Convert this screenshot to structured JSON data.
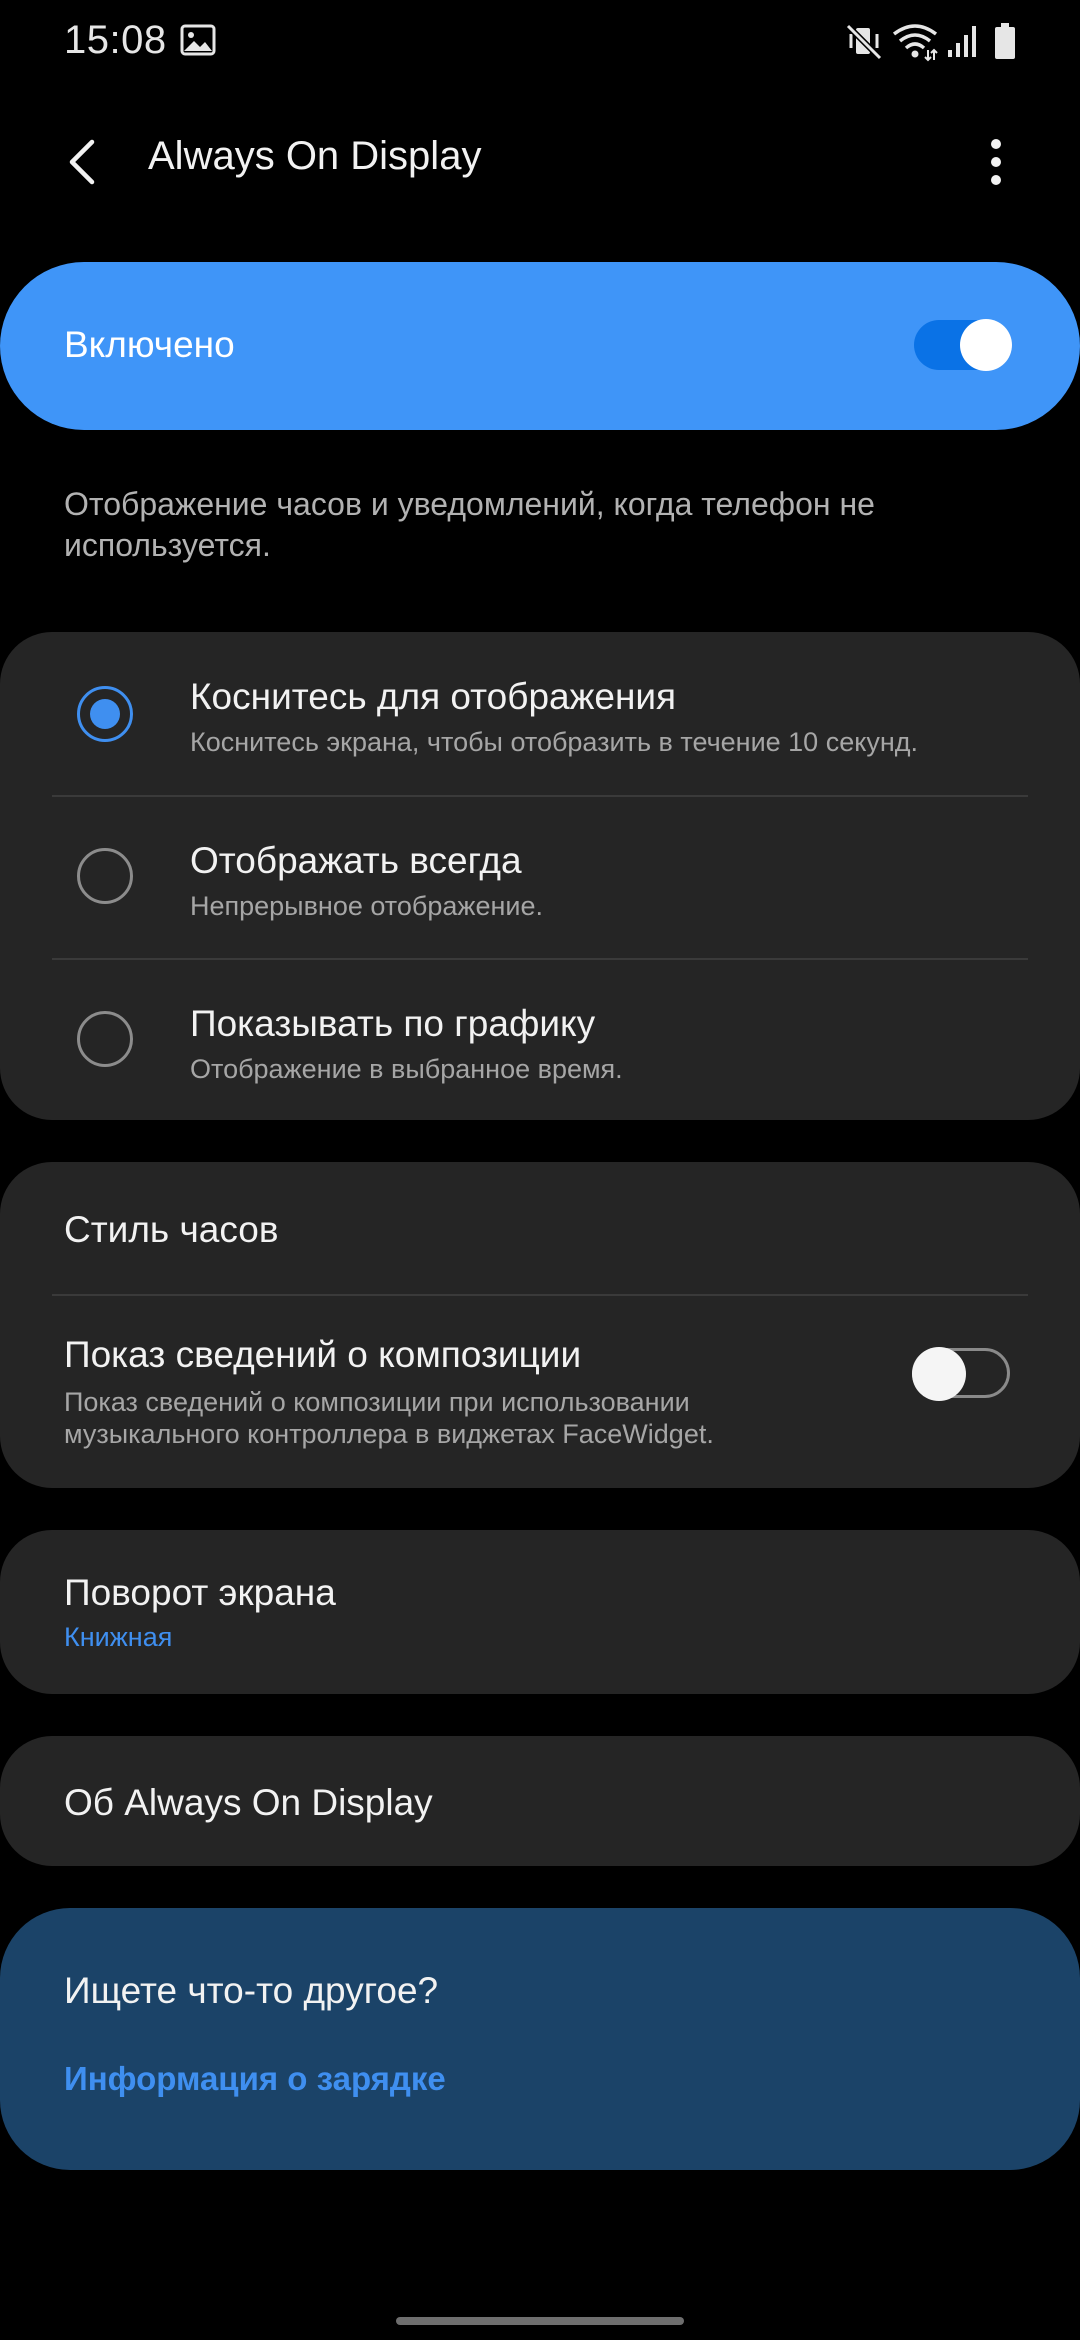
{
  "status_bar": {
    "time": "15:08",
    "icons": [
      "gallery-icon",
      "vibrate-mute-icon",
      "wifi-icon",
      "signal-icon",
      "battery-icon"
    ]
  },
  "app_bar": {
    "title": "Always On Display",
    "back_icon": "back-arrow-icon",
    "more_icon": "more-vert-icon"
  },
  "master_switch": {
    "label": "Включено",
    "on": true
  },
  "description": "Отображение часов и уведомлений, когда телефон не используется.",
  "display_modes": [
    {
      "title": "Коснитесь для отображения",
      "subtitle": "Коснитесь экрана, чтобы отобразить в течение 10 секунд.",
      "selected": true
    },
    {
      "title": "Отображать всегда",
      "subtitle": "Непрерывное отображение.",
      "selected": false
    },
    {
      "title": "Показывать по графику",
      "subtitle": "Отображение в выбранное время.",
      "selected": false
    }
  ],
  "clock_card": {
    "clock_style": "Стиль часов",
    "music_info_title": "Показ сведений о композиции",
    "music_info_subtitle": "Показ сведений о композиции при использовании музыкального контроллера в виджетах FaceWidget.",
    "music_info_on": false
  },
  "rotation": {
    "title": "Поворот экрана",
    "value": "Книжная"
  },
  "about": {
    "label": "Об Always On Display"
  },
  "suggestions": {
    "title": "Ищете что-то другое?",
    "link": "Информация о зарядке"
  },
  "colors": {
    "accent": "#3f8ff0",
    "master_card": "#3f95f8",
    "card_bg": "#252525",
    "suggestion_bg": "#1b4368",
    "background": "#000000"
  }
}
